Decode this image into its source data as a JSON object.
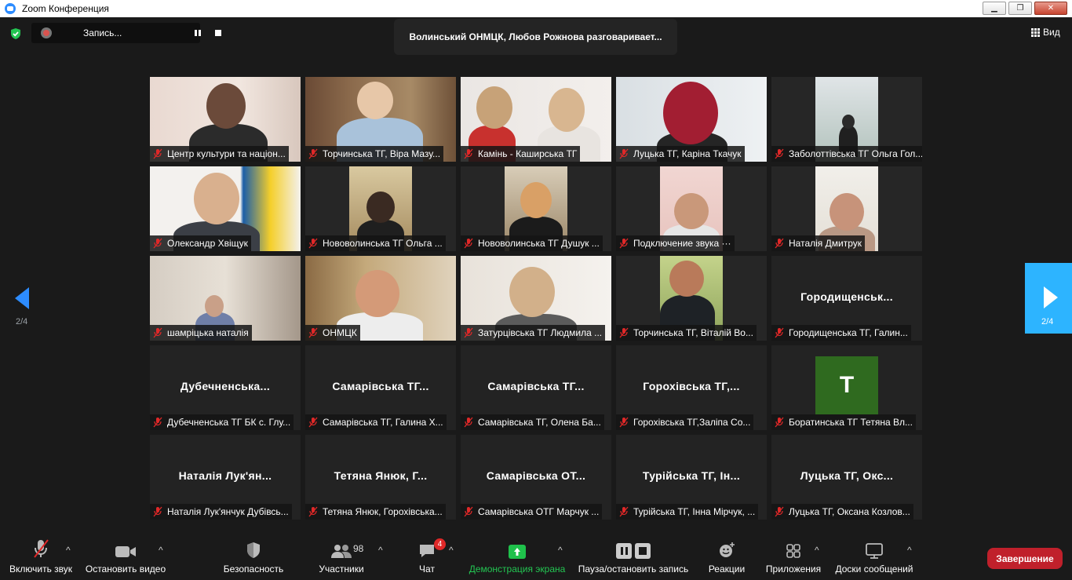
{
  "window": {
    "title": "Zoom Конференция"
  },
  "top": {
    "recording_label": "Запись...",
    "speaker_text": "Волинський ОНМЦК, Любов Рожнова разговаривает...",
    "view_label": "Вид"
  },
  "pager": {
    "left": "2/4",
    "right": "2/4"
  },
  "tiles": [
    {
      "label": "Центр культури та націон...",
      "center": ""
    },
    {
      "label": "Торчинська ТГ, Віра Мазу...",
      "center": ""
    },
    {
      "label": "Камінь - Каширська ТГ",
      "center": ""
    },
    {
      "label": "Луцька ТГ, Каріна Ткачук",
      "center": ""
    },
    {
      "label": "Заболоттівська ТГ Ольга Гол...",
      "center": ""
    },
    {
      "label": "Олександр Хвіщук",
      "center": ""
    },
    {
      "label": "Нововолинська ТГ Ольга ...",
      "center": ""
    },
    {
      "label": "Нововолинська ТГ Душук ...",
      "center": ""
    },
    {
      "label": "Подключение звука ···",
      "center": ""
    },
    {
      "label": "Наталія Дмитрук",
      "center": ""
    },
    {
      "label": "шамріцька наталія",
      "center": ""
    },
    {
      "label": "ОНМЦК",
      "center": ""
    },
    {
      "label": "Затурцівська ТГ Людмила ...",
      "center": ""
    },
    {
      "label": "Торчинська ТГ, Віталій Во...",
      "center": ""
    },
    {
      "label": "Городищенська ТГ, Галин...",
      "center": "Городищенськ..."
    },
    {
      "label": "Дубечненська ТГ БК с. Глу...",
      "center": "Дубечненська..."
    },
    {
      "label": "Самарівська ТГ, Галина Х...",
      "center": "Самарівська ТГ..."
    },
    {
      "label": "Самарівська ТГ, Олена Ба...",
      "center": "Самарівська ТГ..."
    },
    {
      "label": "Горохівська ТГ,Заліпа Со...",
      "center": "Горохівська ТГ,..."
    },
    {
      "label": "Боратинська ТГ Тетяна  Вл...",
      "center": "",
      "avatar_letter": "T"
    },
    {
      "label": "Наталія Лук'янчук Дубівсь...",
      "center": "Наталія Лук'ян..."
    },
    {
      "label": "Тетяна Янюк, Горохівська...",
      "center": "Тетяна Янюк, Г..."
    },
    {
      "label": "Самарівська ОТГ Марчук ...",
      "center": "Самарівська ОТ..."
    },
    {
      "label": "Турійська ТГ, Інна Мірчук, ...",
      "center": "Турійська ТГ, Ін..."
    },
    {
      "label": "Луцька ТГ, Оксана Козлов...",
      "center": "Луцька ТГ, Окс..."
    }
  ],
  "toolbar": {
    "audio": "Включить звук",
    "video": "Остановить видео",
    "security": "Безопасность",
    "participants": "Участники",
    "participants_count": "98",
    "chat": "Чат",
    "chat_badge": "4",
    "share": "Демонстрация экрана",
    "record": "Пауза/остановить запись",
    "reactions": "Реакции",
    "apps": "Приложения",
    "whiteboards": "Доски сообщений",
    "end": "Завершение"
  },
  "colors": {
    "accent": "#2d8cff",
    "share_green": "#1fc14b",
    "end_red": "#c0202b",
    "muted_red": "#e02828"
  },
  "icons": [
    "shield-icon",
    "record-icon",
    "pause-icon",
    "stop-icon",
    "grid-view-icon",
    "mic-muted-icon",
    "camera-icon",
    "participants-icon",
    "chat-icon",
    "share-screen-icon",
    "reaction-icon",
    "apps-icon",
    "whiteboard-icon"
  ]
}
